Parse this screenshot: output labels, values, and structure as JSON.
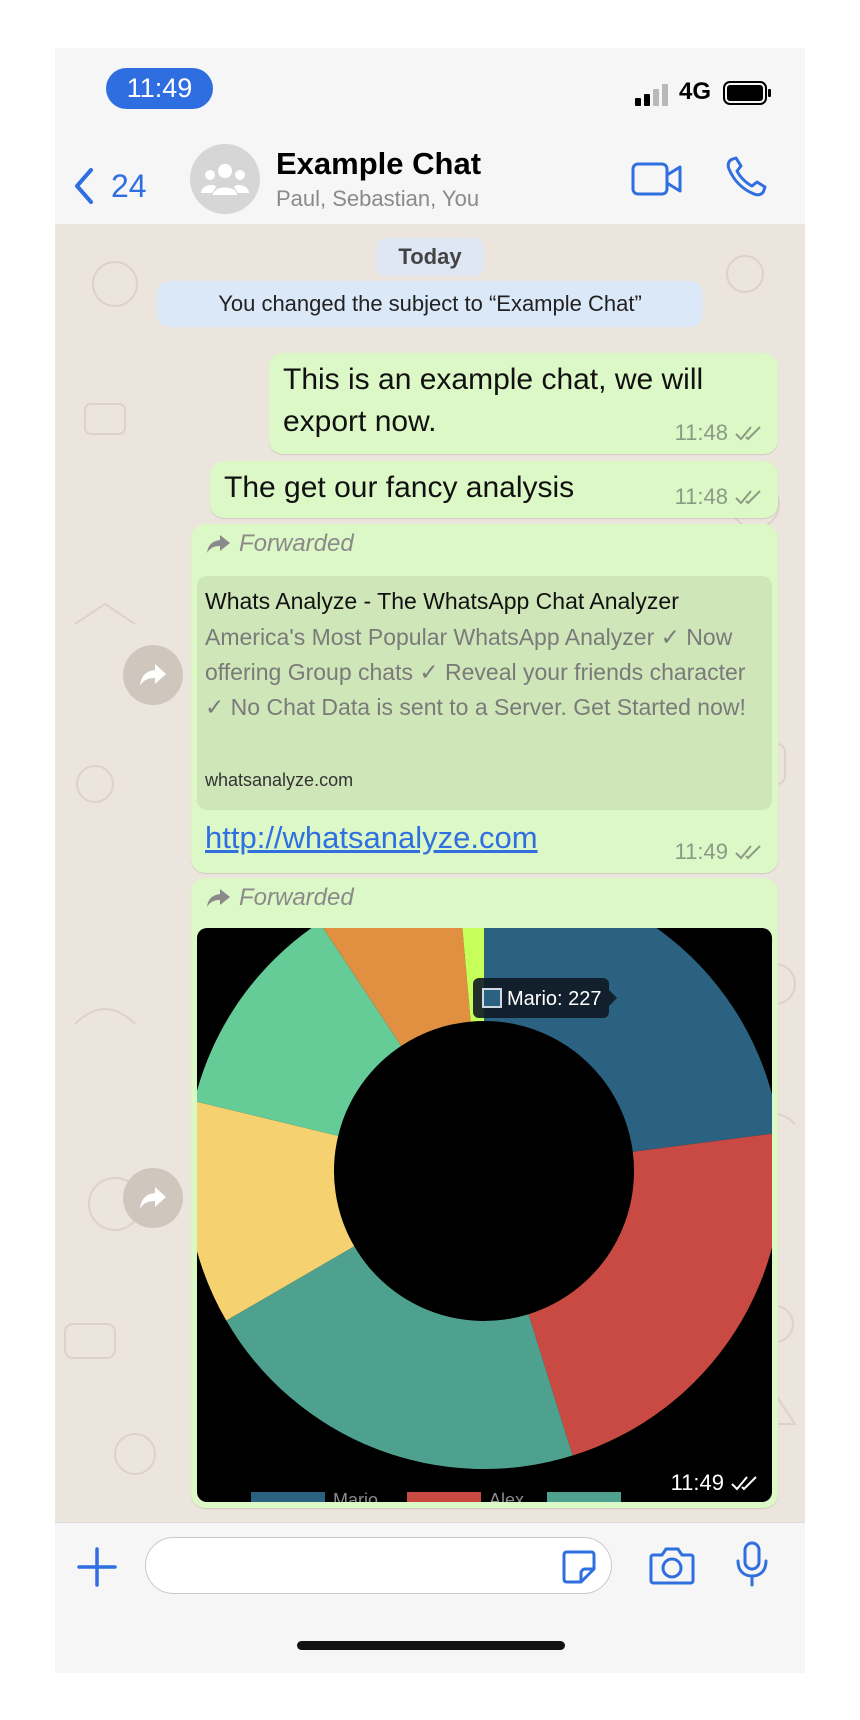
{
  "status_bar": {
    "time": "11:49",
    "network": "4G"
  },
  "header": {
    "back_count": "24",
    "title": "Example Chat",
    "members": "Paul, Sebastian, You"
  },
  "chat": {
    "date_label": "Today",
    "system_message": "You changed the subject to “Example Chat”",
    "messages": [
      {
        "text": "This is an example chat, we will export now.",
        "time": "11:48"
      },
      {
        "text": "The get our fancy analysis",
        "time": "11:48"
      },
      {
        "forwarded_label": "Forwarded",
        "preview_title": "Whats Analyze - The WhatsApp Chat Analyzer",
        "preview_description": "America's Most Popular WhatsApp Analyzer ✓ Now offering Group chats ✓ Reveal your friends character ✓ No Chat Data is sent to a Server. Get Started now!",
        "preview_domain": "whatsanalyze.com",
        "link": "http://whatsanalyze.com",
        "time": "11:49"
      },
      {
        "forwarded_label": "Forwarded",
        "time": "11:49",
        "tooltip": "Mario: 227"
      }
    ]
  },
  "chart_data": {
    "type": "pie",
    "title": "",
    "donut": true,
    "tooltip": "Mario: 227",
    "slices": [
      {
        "name": "Mario",
        "value": 227,
        "color": "#2b6181"
      },
      {
        "name": "Alex",
        "value": 220,
        "color": "#c94a42"
      },
      {
        "name": "",
        "value": 212,
        "color": "#4fa18f"
      },
      {
        "name": "",
        "value": 120,
        "color": "#f5d26f"
      },
      {
        "name": "",
        "value": 118,
        "color": "#65cc98"
      },
      {
        "name": "",
        "value": 78,
        "color": "#e09040"
      },
      {
        "name": "",
        "value": 14,
        "color": "#c6ff5a"
      }
    ],
    "legend_visible": [
      "Mario",
      "Alex"
    ]
  },
  "input": {
    "placeholder": ""
  },
  "colors": {
    "accent": "#2f6fe0",
    "bubble": "#dcf8c6",
    "wallpaper": "#ece5dd"
  },
  "icons": [
    "signal-icon",
    "battery-icon",
    "back-chevron-icon",
    "group-avatar-icon",
    "video-call-icon",
    "phone-icon",
    "forward-arrow-icon",
    "double-check-icon",
    "plus-icon",
    "sticker-icon",
    "camera-icon",
    "microphone-icon"
  ]
}
